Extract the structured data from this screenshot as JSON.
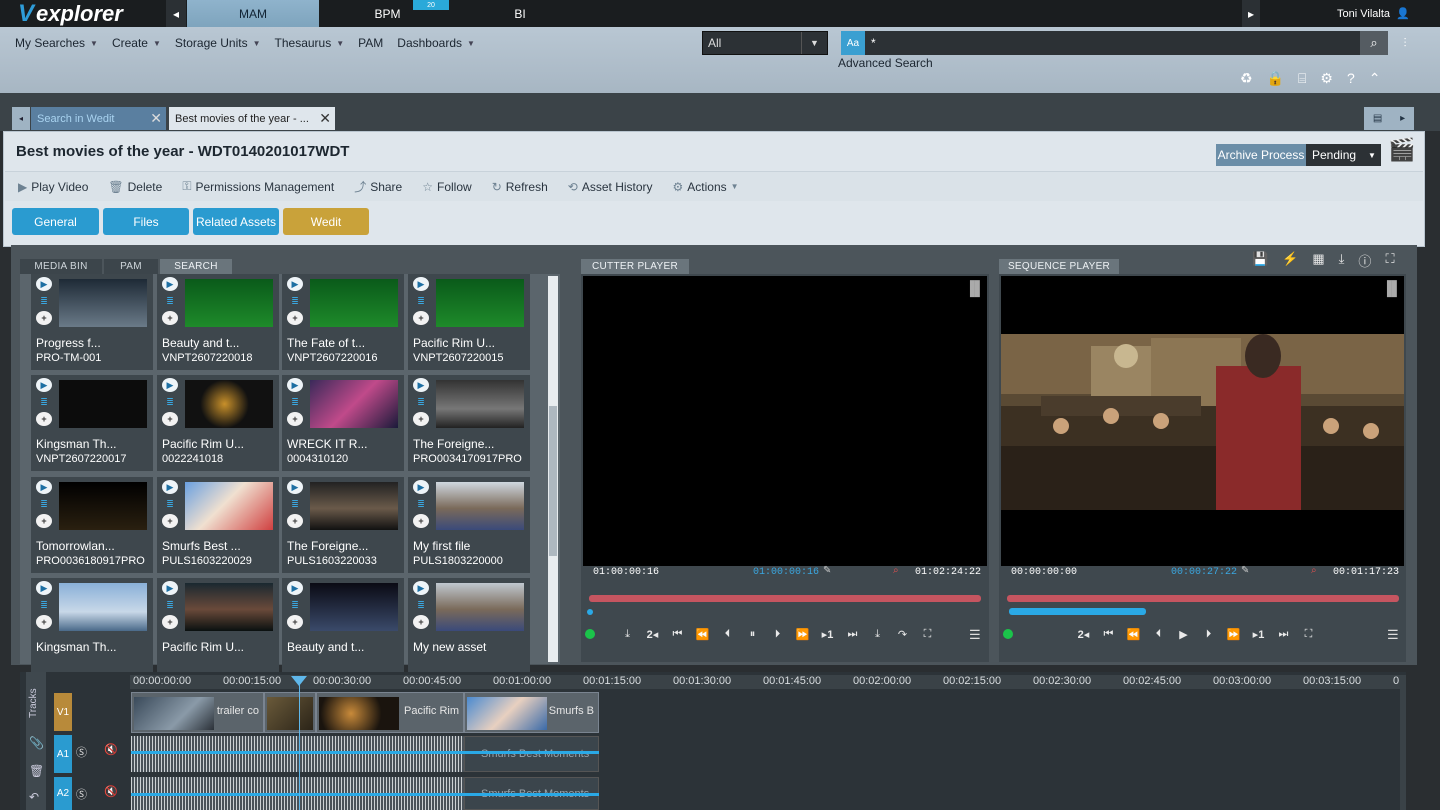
{
  "app": {
    "logo": "explorer",
    "user": "Toni Vilalta"
  },
  "top_tabs": [
    {
      "label": "MAM"
    },
    {
      "label": "BPM"
    },
    {
      "label": "BI"
    }
  ],
  "bpm_badge": "20",
  "menus": [
    {
      "label": "My Searches"
    },
    {
      "label": "Create"
    },
    {
      "label": "Storage Units"
    },
    {
      "label": "Thesaurus"
    },
    {
      "label": "PAM"
    },
    {
      "label": "Dashboards"
    }
  ],
  "search": {
    "scope": "All",
    "case_label": "Aa",
    "value": "*",
    "advanced": "Advanced Search"
  },
  "workspace_tabs": [
    {
      "label": "Search in Wedit"
    },
    {
      "label": "Best movies of the year - ..."
    }
  ],
  "asset": {
    "title": "Best movies of the year - WDT0140201017WDT",
    "archive_label": "Archive Process",
    "archive_value": "Pending"
  },
  "actions": [
    {
      "label": "Play Video",
      "icon": "play-icon"
    },
    {
      "label": "Delete",
      "icon": "trash-icon"
    },
    {
      "label": "Permissions Management",
      "icon": "permissions-icon"
    },
    {
      "label": "Share",
      "icon": "share-icon"
    },
    {
      "label": "Follow",
      "icon": "star-icon"
    },
    {
      "label": "Refresh",
      "icon": "refresh-icon"
    },
    {
      "label": "Asset History",
      "icon": "history-icon"
    },
    {
      "label": "Actions",
      "icon": "gear-icon"
    }
  ],
  "section_tabs": [
    {
      "label": "General",
      "color": "#2a9bd0"
    },
    {
      "label": "Files",
      "color": "#2a9bd0"
    },
    {
      "label": "Related Assets",
      "color": "#2a9bd0"
    },
    {
      "label": "Wedit",
      "color": "#c9a23a"
    }
  ],
  "bin_tabs": [
    {
      "label": "MEDIA BIN"
    },
    {
      "label": "PAM"
    },
    {
      "label": "SEARCH"
    }
  ],
  "media_items": [
    {
      "title": "Progress f...",
      "code": "PRO-TM-001"
    },
    {
      "title": "Beauty and t...",
      "code": "VNPT2607220018"
    },
    {
      "title": "The Fate of t...",
      "code": "VNPT2607220016"
    },
    {
      "title": "Pacific Rim U...",
      "code": "VNPT2607220015"
    },
    {
      "title": "Kingsman Th...",
      "code": "VNPT2607220017"
    },
    {
      "title": "Pacific Rim U...",
      "code": "0022241018"
    },
    {
      "title": "WRECK IT R...",
      "code": "0004310120"
    },
    {
      "title": "The Foreigne...",
      "code": "PRO0034170917PRO"
    },
    {
      "title": "Tomorrowlan...",
      "code": "PRO0036180917PRO"
    },
    {
      "title": "Smurfs Best ...",
      "code": "PULS1603220029"
    },
    {
      "title": "The Foreigne...",
      "code": "PULS1603220033"
    },
    {
      "title": "My first file",
      "code": "PULS1803220000"
    },
    {
      "title": "Kingsman Th...",
      "code": ""
    },
    {
      "title": "Pacific Rim U...",
      "code": ""
    },
    {
      "title": "Beauty and t...",
      "code": ""
    },
    {
      "title": "My new asset",
      "code": ""
    }
  ],
  "cutter": {
    "label": "CUTTER PLAYER",
    "tc_left": "01:00:00:16",
    "tc_mid": "01:00:00:16",
    "tc_right": "01:02:24:22"
  },
  "sequence": {
    "label": "SEQUENCE PLAYER",
    "tc_left": "00:00:00:00",
    "tc_mid": "00:00:27:22",
    "tc_right": "00:01:17:23",
    "progress": 0.35
  },
  "player_ctrl": {
    "speed_back": "2",
    "speed_fwd": "1"
  },
  "timeline": {
    "tracks_label": "Tracks",
    "tracks": [
      {
        "label": "V1"
      },
      {
        "label": "A1"
      },
      {
        "label": "A2"
      }
    ],
    "ruler": [
      "00:00:00:00",
      "00:00:15:00",
      "00:00:30:00",
      "00:00:45:00",
      "00:01:00:00",
      "00:01:15:00",
      "00:01:30:00",
      "00:01:45:00",
      "00:02:00:00",
      "00:02:15:00",
      "00:02:30:00",
      "00:02:45:00",
      "00:03:00:00",
      "00:03:15:00",
      "0"
    ],
    "clips": [
      {
        "label": "trailer co"
      },
      {
        "label": "Pacific Rim"
      },
      {
        "label": "Smurfs B"
      }
    ],
    "audio_clip": "Smurfs Best Moments"
  }
}
